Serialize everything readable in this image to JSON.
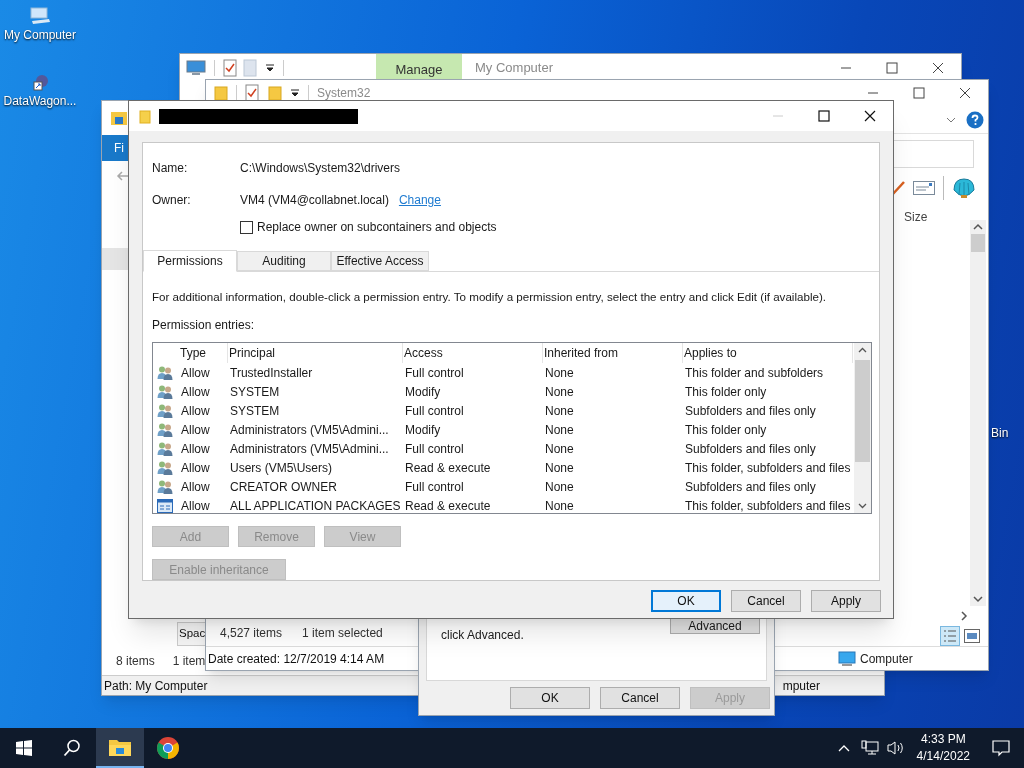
{
  "desktop_icons": [
    {
      "label": "My Computer"
    },
    {
      "label": "DataWagon..."
    },
    {
      "label": "Bin"
    }
  ],
  "window_my_computer": {
    "ribbon_tab": "Manage",
    "title": "My Computer"
  },
  "window_system32": {
    "title": "System32",
    "column": "Size",
    "item_count": "4,527 items",
    "selection": "1 item selected",
    "date_created": "Date created: 12/7/2019 4:14 AM",
    "location": "Computer"
  },
  "window_left": {
    "ribbon_tab": "Fi",
    "space": "Spac",
    "item_count": "8 items",
    "selection": "1 item",
    "path": "Path: My Computer",
    "path_tail": "mputer"
  },
  "properties_dialog": {
    "text": "click Advanced.",
    "advanced_button": "Advanced",
    "buttons": [
      {
        "label": "OK",
        "disabled": false
      },
      {
        "label": "Cancel",
        "disabled": false
      },
      {
        "label": "Apply",
        "disabled": true
      }
    ]
  },
  "dialog": {
    "name_label": "Name:",
    "name_value": "C:\\Windows\\System32\\drivers",
    "owner_label": "Owner:",
    "owner_value": "VM4 (VM4@collabnet.local)",
    "change_link": "Change",
    "replace_owner": {
      "label": "Replace owner on subcontainers and objects",
      "checked": false
    },
    "tabs": [
      {
        "label": "Permissions",
        "selected": true
      },
      {
        "label": "Auditing",
        "selected": false
      },
      {
        "label": "Effective Access",
        "selected": false
      }
    ],
    "info": "For additional information, double-click a permission entry. To modify a permission entry, select the entry and click Edit (if available).",
    "entries_label": "Permission entries:",
    "columns": [
      "Type",
      "Principal",
      "Access",
      "Inherited from",
      "Applies to"
    ],
    "rows": [
      {
        "kind": "user",
        "type": "Allow",
        "principal": "TrustedInstaller",
        "access": "Full control",
        "inherited_from": "None",
        "applies_to": "This folder and subfolders"
      },
      {
        "kind": "user",
        "type": "Allow",
        "principal": "SYSTEM",
        "access": "Modify",
        "inherited_from": "None",
        "applies_to": "This folder only"
      },
      {
        "kind": "user",
        "type": "Allow",
        "principal": "SYSTEM",
        "access": "Full control",
        "inherited_from": "None",
        "applies_to": "Subfolders and files only"
      },
      {
        "kind": "user",
        "type": "Allow",
        "principal": "Administrators (VM5\\Admini...",
        "access": "Modify",
        "inherited_from": "None",
        "applies_to": "This folder only"
      },
      {
        "kind": "user",
        "type": "Allow",
        "principal": "Administrators (VM5\\Admini...",
        "access": "Full control",
        "inherited_from": "None",
        "applies_to": "Subfolders and files only"
      },
      {
        "kind": "user",
        "type": "Allow",
        "principal": "Users (VM5\\Users)",
        "access": "Read & execute",
        "inherited_from": "None",
        "applies_to": "This folder, subfolders and files"
      },
      {
        "kind": "user",
        "type": "Allow",
        "principal": "CREATOR OWNER",
        "access": "Full control",
        "inherited_from": "None",
        "applies_to": "Subfolders and files only"
      },
      {
        "kind": "package",
        "type": "Allow",
        "principal": "ALL APPLICATION PACKAGES",
        "access": "Read & execute",
        "inherited_from": "None",
        "applies_to": "This folder, subfolders and files"
      }
    ],
    "entry_buttons": [
      {
        "label": "Add",
        "disabled": true
      },
      {
        "label": "Remove",
        "disabled": true
      },
      {
        "label": "View",
        "disabled": true
      }
    ],
    "enable_inheritance": {
      "label": "Enable inheritance",
      "disabled": true
    },
    "footer_buttons": [
      {
        "label": "OK",
        "default": true
      },
      {
        "label": "Cancel",
        "default": false
      },
      {
        "label": "Apply",
        "default": false
      }
    ]
  },
  "taskbar": {
    "time": "4:33 PM",
    "date": "4/14/2022"
  }
}
